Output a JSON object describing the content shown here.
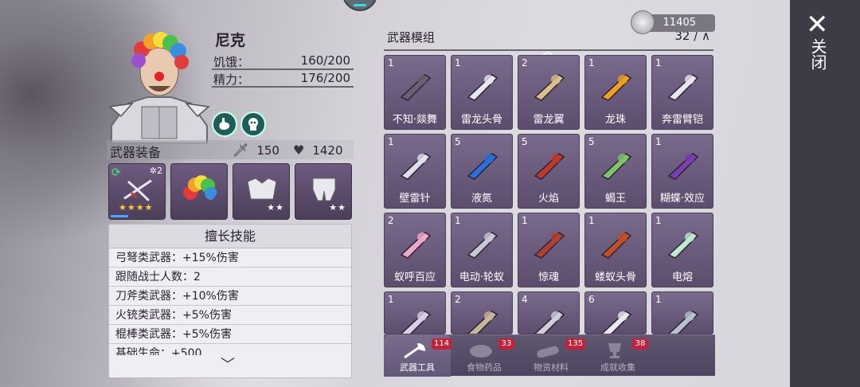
{
  "character": {
    "name": "尼克",
    "stats": [
      {
        "label": "饥饿：",
        "value": "160/200"
      },
      {
        "label": "精力：",
        "value": "176/200"
      }
    ],
    "skill_icons": [
      "stomach-icon",
      "brain-icon"
    ]
  },
  "equipment": {
    "title": "武器装备",
    "attack": "150",
    "health": "1420",
    "slots": [
      {
        "name": "crossbow",
        "stars": "★★★★",
        "count": "2"
      },
      {
        "name": "rainbow-wig",
        "stars": ""
      },
      {
        "name": "armor-chest",
        "stars": "★★"
      },
      {
        "name": "armor-legs",
        "stars": "★★"
      }
    ]
  },
  "skills": {
    "title": "擅长技能",
    "lines": [
      "弓弩类武器：+15%伤害",
      "跟随战士人数：2",
      "刀斧类武器：+10%伤害",
      "火铳类武器：+5%伤害",
      "棍棒类武器：+5%伤害",
      "基础生命：+500"
    ]
  },
  "currency": {
    "value": "11405"
  },
  "weapons": {
    "title": "武器模组",
    "count": "32 / ∧",
    "items": [
      {
        "count": "1",
        "label": "不知·燚舞",
        "color": "#6b6070"
      },
      {
        "count": "1",
        "label": "雷龙头骨",
        "color": "#e8e6f0"
      },
      {
        "count": "2",
        "label": "雷龙翼",
        "color": "#d8c08a"
      },
      {
        "count": "1",
        "label": "龙珠",
        "color": "#f0a020"
      },
      {
        "count": "1",
        "label": "奔雷臂铠",
        "color": "#e8e6f0"
      },
      {
        "count": "1",
        "label": "壁雷针",
        "color": "#dfe0ea"
      },
      {
        "count": "5",
        "label": "液氮",
        "color": "#2b6fd8"
      },
      {
        "count": "5",
        "label": "火焰",
        "color": "#c0392b"
      },
      {
        "count": "5",
        "label": "蝎王",
        "color": "#7fc46a"
      },
      {
        "count": "1",
        "label": "糊蝶·效应",
        "color": "#7a3fb0"
      },
      {
        "count": "2",
        "label": "蚁呼百应",
        "color": "#f0a8c8"
      },
      {
        "count": "1",
        "label": "电动·轮蚁",
        "color": "#c8c8d4"
      },
      {
        "count": "1",
        "label": "惊魂",
        "color": "#b04030"
      },
      {
        "count": "1",
        "label": "蝼蚁头骨",
        "color": "#c0502a"
      },
      {
        "count": "1",
        "label": "电熔",
        "color": "#bfe8d0"
      },
      {
        "count": "1",
        "label": "",
        "color": "#d8d0e8"
      },
      {
        "count": "2",
        "label": "",
        "color": "#c8b89a"
      },
      {
        "count": "4",
        "label": "",
        "color": "#d0ccd8"
      },
      {
        "count": "6",
        "label": "",
        "color": "#e8e8ee"
      },
      {
        "count": "1",
        "label": "",
        "color": "#b8c0d0"
      }
    ]
  },
  "tabs": [
    {
      "label": "武器工具",
      "badge": "114",
      "active": true,
      "icon": "axe-icon"
    },
    {
      "label": "食物药品",
      "badge": "33",
      "active": false,
      "icon": "food-icon"
    },
    {
      "label": "物资材料",
      "badge": "135",
      "active": false,
      "icon": "wood-icon"
    },
    {
      "label": "成就收集",
      "badge": "38",
      "active": false,
      "icon": "trophy-icon"
    }
  ],
  "close": {
    "label": "关闭"
  }
}
